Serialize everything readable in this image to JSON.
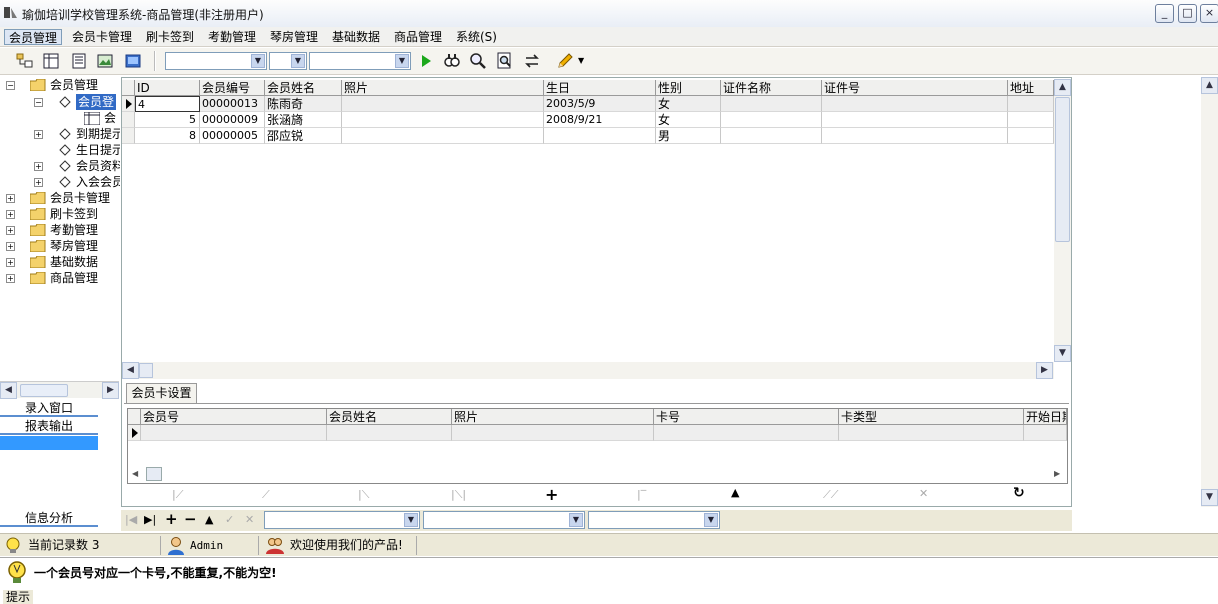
{
  "window": {
    "title": "瑜伽培训学校管理系统-商品管理(非注册用户)",
    "min": "_",
    "max": "□",
    "close": "×"
  },
  "menu": [
    "会员管理",
    "会员卡管理",
    "刷卡签到",
    "考勤管理",
    "琴房管理",
    "基础数据",
    "商品管理",
    "系统(S)"
  ],
  "tree": {
    "root": "会员管理",
    "sub1": "会员登",
    "sub1child": "会",
    "items": [
      "到期提示",
      "生日提示",
      "会员资料",
      "入会会员"
    ],
    "top": [
      "会员卡管理",
      "刷卡签到",
      "考勤管理",
      "琴房管理",
      "基础数据",
      "商品管理"
    ]
  },
  "side_nav": {
    "entry": "录入窗口",
    "report": "报表输出",
    "analysis": "信息分析"
  },
  "grid": {
    "columns": [
      "ID",
      "会员编号",
      "会员姓名",
      "照片",
      "生日",
      "性别",
      "证件名称",
      "证件号",
      "地址"
    ],
    "rows": [
      [
        "4",
        "00000013",
        "陈雨奇",
        "",
        "2003/5/9",
        "女",
        "",
        "",
        ""
      ],
      [
        "5",
        "00000009",
        "张涵旖",
        "",
        "2008/9/21",
        "女",
        "",
        "",
        ""
      ],
      [
        "8",
        "00000005",
        "邵应锐",
        "",
        "",
        "男",
        "",
        "",
        ""
      ]
    ]
  },
  "detail": {
    "tab": "会员卡设置",
    "columns": [
      "会员号",
      "会员姓名",
      "照片",
      "卡号",
      "卡类型",
      "开始日期"
    ]
  },
  "status": {
    "records": "当前记录数 3",
    "user": "Admin",
    "welcome": "欢迎使用我们的产品!"
  },
  "hint": {
    "text": "一个会员号对应一个卡号,不能重复,不能为空!",
    "label": "提示"
  }
}
